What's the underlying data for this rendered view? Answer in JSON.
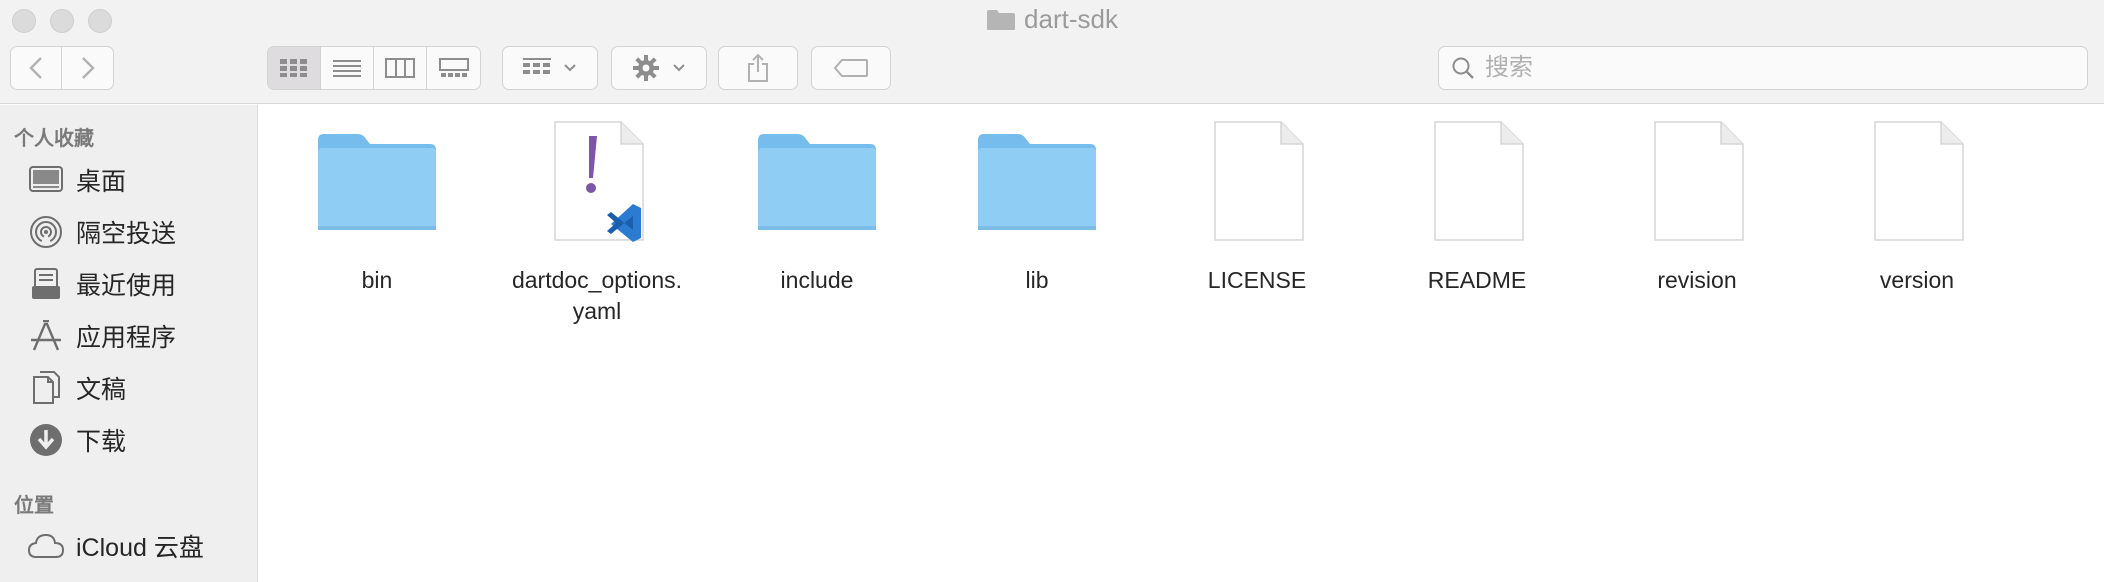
{
  "window": {
    "title": "dart-sdk"
  },
  "toolbar": {
    "search_placeholder": "搜索"
  },
  "sidebar": {
    "favorites_title": "个人收藏",
    "favorites": [
      {
        "label": "桌面",
        "icon": "desktop-icon"
      },
      {
        "label": "隔空投送",
        "icon": "airdrop-icon"
      },
      {
        "label": "最近使用",
        "icon": "recents-icon"
      },
      {
        "label": "应用程序",
        "icon": "applications-icon"
      },
      {
        "label": "文稿",
        "icon": "documents-icon"
      },
      {
        "label": "下载",
        "icon": "downloads-icon"
      }
    ],
    "locations_title": "位置",
    "locations": [
      {
        "label": "iCloud 云盘",
        "icon": "icloud-icon"
      }
    ]
  },
  "files": [
    {
      "name": "bin",
      "kind": "folder"
    },
    {
      "name": "dartdoc_options.yaml",
      "kind": "yaml"
    },
    {
      "name": "include",
      "kind": "folder"
    },
    {
      "name": "lib",
      "kind": "folder"
    },
    {
      "name": "LICENSE",
      "kind": "document"
    },
    {
      "name": "README",
      "kind": "document"
    },
    {
      "name": "revision",
      "kind": "document"
    },
    {
      "name": "version",
      "kind": "document"
    }
  ],
  "colors": {
    "folder_body": "#8ecdf5",
    "folder_tab": "#75bdee",
    "yaml_exclaim": "#7d56a8",
    "vscode_blue": "#2b7bd1"
  }
}
